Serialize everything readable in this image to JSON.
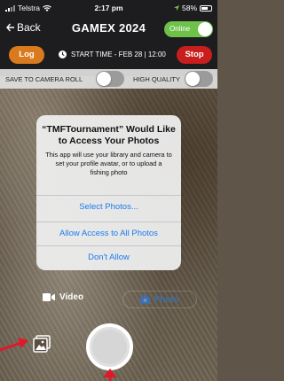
{
  "status_bar": {
    "carrier": "Telstra",
    "time": "2:17 pm",
    "battery": "58%"
  },
  "nav": {
    "back_label": "Back",
    "title": "GAMEX 2024",
    "online_label": "Online"
  },
  "controls": {
    "log_label": "Log",
    "start_time": "START TIME - FEB 28 | 12:00",
    "stop_label": "Stop"
  },
  "options": {
    "save_label": "SAVE TO CAMERA ROLL",
    "save_on": false,
    "hq_label": "HIGH QUALITY",
    "hq_on": false
  },
  "dialog": {
    "title": "“TMFTournament” Would Like to Access Your Photos",
    "message": "This app will use your library and camera to set your profile avatar, or to upload a fishing photo",
    "buttons": [
      "Select Photos...",
      "Allow Access to All Photos",
      "Don't Allow"
    ]
  },
  "camera": {
    "video_label": "Video",
    "photo_label": "Photo"
  },
  "colors": {
    "accent_blue": "#1b7bf0",
    "log_orange": "#d97a1f",
    "stop_red": "#c81e1e",
    "online_green": "#6ec24a",
    "annotation_red": "#e0182a"
  },
  "icons": [
    "signal-icon",
    "wifi-icon",
    "location-icon",
    "battery-icon",
    "back-chevron-icon",
    "clock-icon",
    "video-camera-icon",
    "photo-icon",
    "gallery-icon"
  ]
}
